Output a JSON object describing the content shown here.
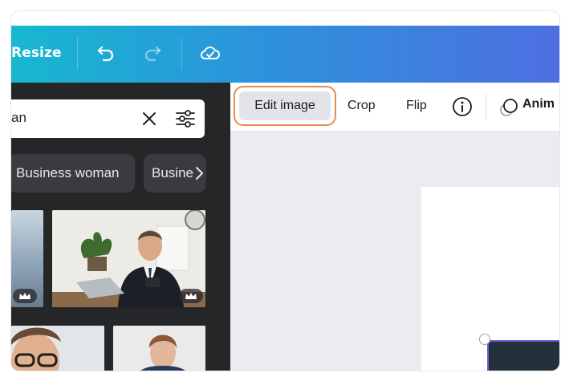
{
  "toolbar": {
    "resize_label": "Resize",
    "undo_icon": "undo-icon",
    "redo_icon": "redo-icon",
    "cloud_icon": "cloud-saved-icon",
    "gradient_start": "#17b8cf",
    "gradient_end": "#4d6fe0"
  },
  "sidebar": {
    "search": {
      "value": "an",
      "clear_icon": "close-icon",
      "filter_icon": "filter-sliders-icon"
    },
    "chips": [
      {
        "label": "Business woman"
      },
      {
        "label": "Busine"
      }
    ],
    "chip_next_icon": "chevron-right-icon",
    "premium_icon": "crown-icon"
  },
  "context_toolbar": {
    "edit_image_label": "Edit image",
    "crop_label": "Crop",
    "flip_label": "Flip",
    "info_icon": "info-icon",
    "animate_label": "Anim",
    "animate_icon": "animate-icon",
    "highlight_color": "#e98a4d"
  }
}
